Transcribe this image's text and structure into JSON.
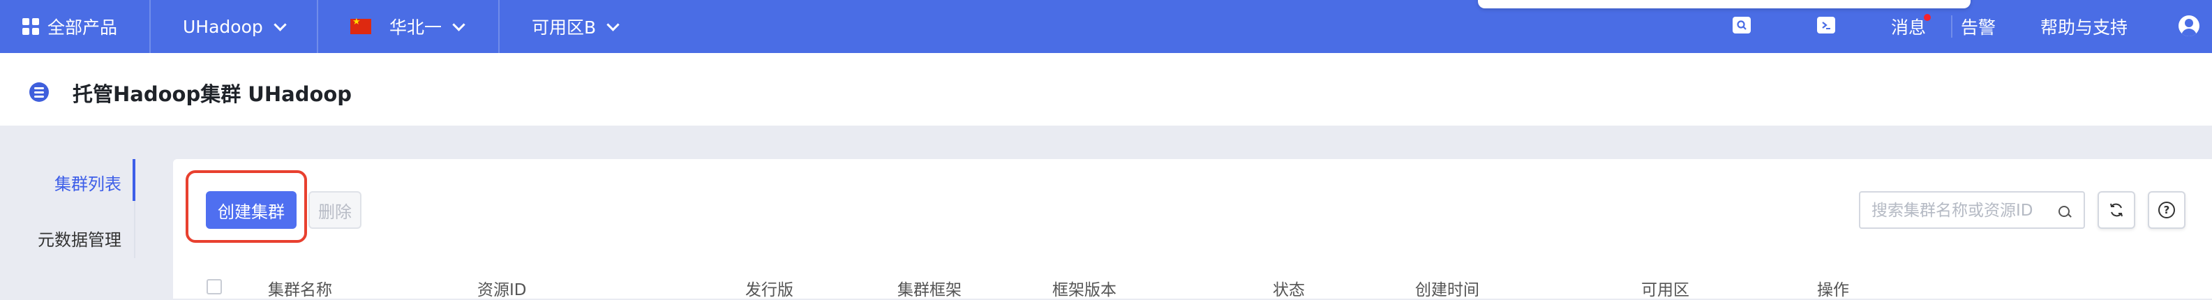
{
  "topbar": {
    "all_products": "全部产品",
    "product": "UHadoop",
    "region": "华北一",
    "zone": "可用区B",
    "messages": "消息",
    "alerts": "告警",
    "help": "帮助与支持"
  },
  "header": {
    "title": "托管Hadoop集群 UHadoop"
  },
  "sidebar": {
    "items": [
      {
        "label": "集群列表",
        "active": true
      },
      {
        "label": "元数据管理",
        "active": false
      }
    ]
  },
  "toolbar": {
    "create_label": "创建集群",
    "delete_label": "删除",
    "search_placeholder": "搜索集群名称或资源ID"
  },
  "table": {
    "columns": [
      "集群名称",
      "资源ID",
      "发行版",
      "集群框架",
      "框架版本",
      "状态",
      "创建时间",
      "可用区",
      "操作"
    ]
  },
  "colors": {
    "topbar_bg": "#4a6de5",
    "primary": "#4f6ff0",
    "highlight_border": "#e8402f",
    "page_bg": "#e9ebf2"
  },
  "icons": [
    "apps-grid-icon",
    "chevron-down-icon",
    "china-flag-icon",
    "search-icon",
    "terminal-icon",
    "user-avatar-icon",
    "list-menu-icon",
    "refresh-icon",
    "help-icon"
  ]
}
